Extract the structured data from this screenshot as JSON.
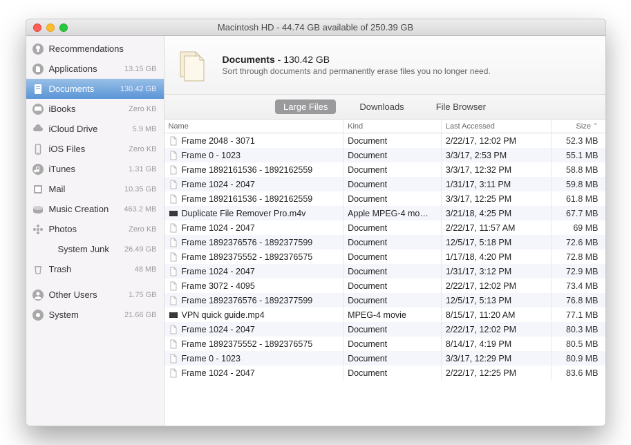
{
  "window_title": "Macintosh HD - 44.74 GB available of 250.39 GB",
  "sidebar": {
    "items": [
      {
        "label": "Recommendations",
        "size": "",
        "icon": "lightbulb",
        "selected": false
      },
      {
        "label": "Applications",
        "size": "13.15 GB",
        "icon": "app",
        "selected": false
      },
      {
        "label": "Documents",
        "size": "130.42 GB",
        "icon": "doc",
        "selected": true
      },
      {
        "label": "iBooks",
        "size": "Zero KB",
        "icon": "book",
        "selected": false
      },
      {
        "label": "iCloud Drive",
        "size": "5.9 MB",
        "icon": "cloud",
        "selected": false
      },
      {
        "label": "iOS Files",
        "size": "Zero KB",
        "icon": "phone",
        "selected": false
      },
      {
        "label": "iTunes",
        "size": "1.31 GB",
        "icon": "music",
        "selected": false
      },
      {
        "label": "Mail",
        "size": "10.35 GB",
        "icon": "stamp",
        "selected": false
      },
      {
        "label": "Music Creation",
        "size": "463.2 MB",
        "icon": "drum",
        "selected": false
      },
      {
        "label": "Photos",
        "size": "Zero KB",
        "icon": "flower",
        "selected": false
      },
      {
        "label": "System Junk",
        "size": "26.49 GB",
        "icon": "blank",
        "indent": true,
        "selected": false
      },
      {
        "label": "Trash",
        "size": "48 MB",
        "icon": "trash",
        "selected": false
      },
      {
        "label": "sep"
      },
      {
        "label": "Other Users",
        "size": "1.75 GB",
        "icon": "users",
        "selected": false
      },
      {
        "label": "System",
        "size": "21.66 GB",
        "icon": "gear",
        "selected": false
      }
    ]
  },
  "header": {
    "title": "Documents",
    "size": "130.42 GB",
    "subtitle": "Sort through documents and permanently erase files you no longer need."
  },
  "tabs": [
    {
      "label": "Large Files",
      "active": true
    },
    {
      "label": "Downloads",
      "active": false
    },
    {
      "label": "File Browser",
      "active": false
    }
  ],
  "columns": {
    "name": "Name",
    "kind": "Kind",
    "last": "Last Accessed",
    "size": "Size"
  },
  "files": [
    {
      "name": "Frame 2048 - 3071",
      "kind": "Document",
      "last": "2/22/17, 12:02 PM",
      "size": "52.3 MB",
      "icon": "blank"
    },
    {
      "name": "Frame 0 - 1023",
      "kind": "Document",
      "last": "3/3/17, 2:53 PM",
      "size": "55.1 MB",
      "icon": "blank"
    },
    {
      "name": "Frame 1892161536 - 1892162559",
      "kind": "Document",
      "last": "3/3/17, 12:32 PM",
      "size": "58.8 MB",
      "icon": "blank"
    },
    {
      "name": "Frame 1024 - 2047",
      "kind": "Document",
      "last": "1/31/17, 3:11 PM",
      "size": "59.8 MB",
      "icon": "blank"
    },
    {
      "name": "Frame 1892161536 - 1892162559",
      "kind": "Document",
      "last": "3/3/17, 12:25 PM",
      "size": "61.8 MB",
      "icon": "blank"
    },
    {
      "name": "Duplicate File Remover Pro.m4v",
      "kind": "Apple MPEG-4 mo…",
      "last": "3/21/18, 4:25 PM",
      "size": "67.7 MB",
      "icon": "video"
    },
    {
      "name": "Frame 1024 - 2047",
      "kind": "Document",
      "last": "2/22/17, 11:57 AM",
      "size": "69 MB",
      "icon": "blank"
    },
    {
      "name": "Frame 1892376576 - 1892377599",
      "kind": "Document",
      "last": "12/5/17, 5:18 PM",
      "size": "72.6 MB",
      "icon": "blank"
    },
    {
      "name": "Frame 1892375552 - 1892376575",
      "kind": "Document",
      "last": "1/17/18, 4:20 PM",
      "size": "72.8 MB",
      "icon": "blank"
    },
    {
      "name": "Frame 1024 - 2047",
      "kind": "Document",
      "last": "1/31/17, 3:12 PM",
      "size": "72.9 MB",
      "icon": "blank"
    },
    {
      "name": "Frame 3072 - 4095",
      "kind": "Document",
      "last": "2/22/17, 12:02 PM",
      "size": "73.4 MB",
      "icon": "blank"
    },
    {
      "name": "Frame 1892376576 - 1892377599",
      "kind": "Document",
      "last": "12/5/17, 5:13 PM",
      "size": "76.8 MB",
      "icon": "blank"
    },
    {
      "name": "VPN quick guide.mp4",
      "kind": "MPEG-4 movie",
      "last": "8/15/17, 11:20 AM",
      "size": "77.1 MB",
      "icon": "video"
    },
    {
      "name": "Frame 1024 - 2047",
      "kind": "Document",
      "last": "2/22/17, 12:02 PM",
      "size": "80.3 MB",
      "icon": "blank"
    },
    {
      "name": "Frame 1892375552 - 1892376575",
      "kind": "Document",
      "last": "8/14/17, 4:19 PM",
      "size": "80.5 MB",
      "icon": "blank"
    },
    {
      "name": "Frame 0 - 1023",
      "kind": "Document",
      "last": "3/3/17, 12:29 PM",
      "size": "80.9 MB",
      "icon": "blank"
    },
    {
      "name": "Frame 1024 - 2047",
      "kind": "Document",
      "last": "2/22/17, 12:25 PM",
      "size": "83.6 MB",
      "icon": "blank"
    }
  ]
}
